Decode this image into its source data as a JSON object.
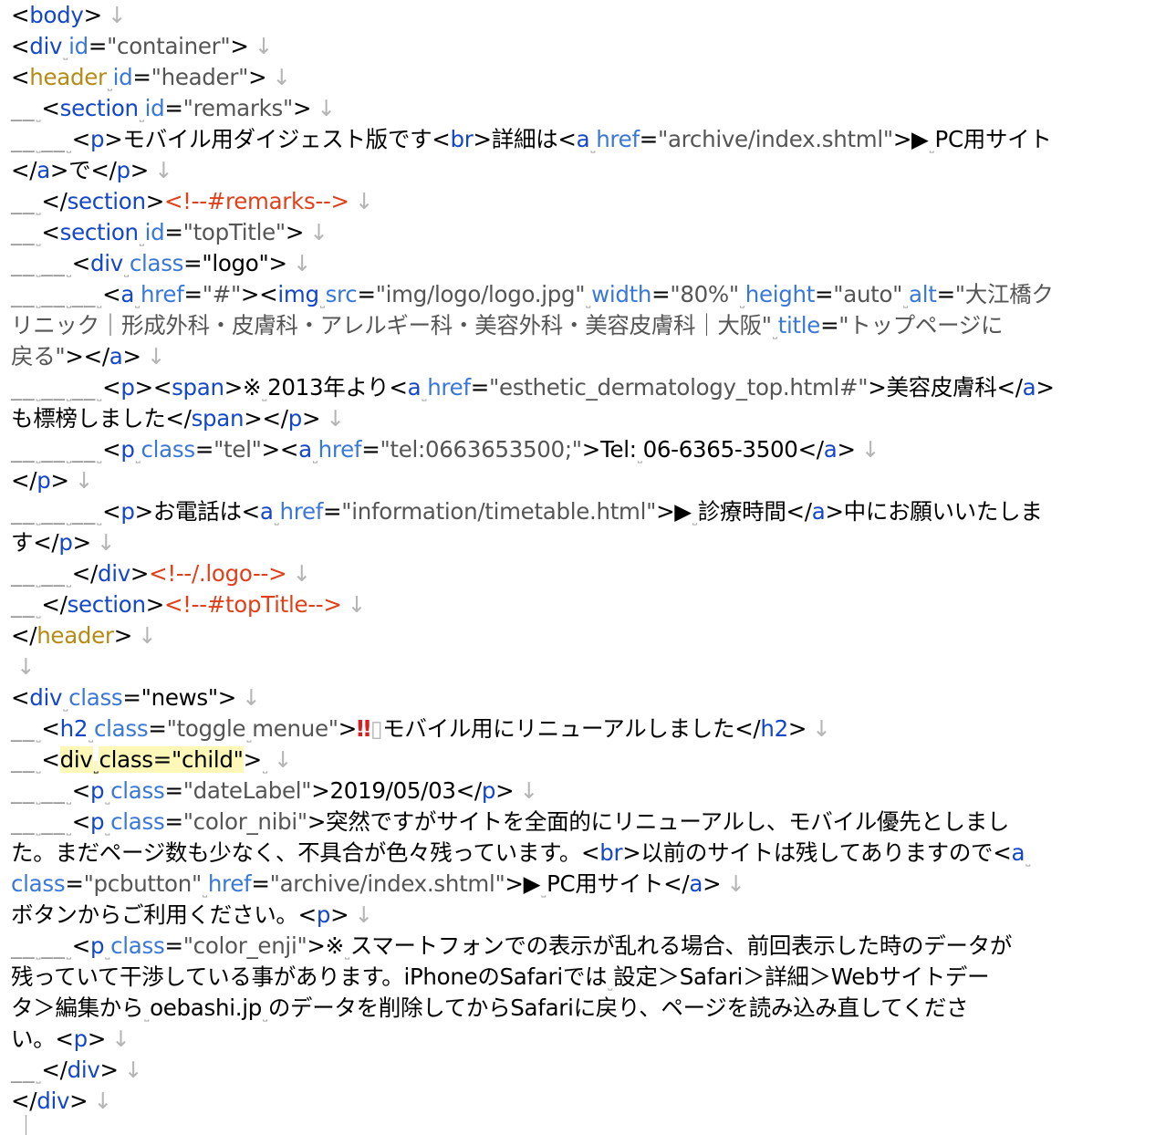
{
  "editor": {
    "lines": [
      [
        [
          "t",
          "<"
        ],
        [
          "g",
          "body"
        ],
        [
          "t",
          ">"
        ],
        [
          "eol",
          "↓"
        ]
      ],
      [
        [
          "t",
          "<"
        ],
        [
          "g",
          "div"
        ],
        [
          "s",
          "˽"
        ],
        [
          "a",
          "id"
        ],
        [
          "t",
          "="
        ],
        [
          "v",
          "\"container\""
        ],
        [
          "t",
          ">"
        ],
        [
          "eol",
          "↓"
        ]
      ],
      [
        [
          "t",
          "<"
        ],
        [
          "h",
          "header"
        ],
        [
          "s",
          "˽"
        ],
        [
          "a",
          "id"
        ],
        [
          "t",
          "="
        ],
        [
          "v",
          "\"header\""
        ],
        [
          "t",
          ">"
        ],
        [
          "eol",
          "↓"
        ]
      ],
      [
        [
          "i",
          "__"
        ],
        [
          "s",
          "˽"
        ],
        [
          "t",
          "<"
        ],
        [
          "g",
          "section"
        ],
        [
          "s",
          "˽"
        ],
        [
          "a",
          "id"
        ],
        [
          "t",
          "="
        ],
        [
          "v",
          "\"remarks\""
        ],
        [
          "t",
          ">"
        ],
        [
          "eol",
          "↓"
        ]
      ],
      [
        [
          "i",
          "__"
        ],
        [
          "s",
          "˽"
        ],
        [
          "i",
          "__"
        ],
        [
          "s",
          "˽"
        ],
        [
          "t",
          "<"
        ],
        [
          "g",
          "p"
        ],
        [
          "t",
          ">モバイル用ダイジェスト版です<"
        ],
        [
          "g",
          "br"
        ],
        [
          "t",
          ">詳細は<"
        ],
        [
          "g",
          "a"
        ],
        [
          "s",
          "˽"
        ],
        [
          "a",
          "href"
        ],
        [
          "t",
          "="
        ],
        [
          "v",
          "\"archive/index.shtml\""
        ],
        [
          "t",
          ">▶"
        ],
        [
          "s",
          "˽"
        ],
        [
          "t",
          "PC用サイト"
        ]
      ],
      [
        [
          "t",
          "</"
        ],
        [
          "g",
          "a"
        ],
        [
          "t",
          ">で</"
        ],
        [
          "g",
          "p"
        ],
        [
          "t",
          ">"
        ],
        [
          "eol",
          "↓"
        ]
      ],
      [
        [
          "i",
          "__"
        ],
        [
          "s",
          "˽"
        ],
        [
          "t",
          "</"
        ],
        [
          "g",
          "section"
        ],
        [
          "t",
          ">"
        ],
        [
          "c",
          "<!--#remarks-->"
        ],
        [
          "eol",
          "↓"
        ]
      ],
      [
        [
          "i",
          "__"
        ],
        [
          "s",
          "˽"
        ],
        [
          "t",
          "<"
        ],
        [
          "g",
          "section"
        ],
        [
          "s",
          "˽"
        ],
        [
          "a",
          "id"
        ],
        [
          "t",
          "="
        ],
        [
          "v",
          "\"topTitle\""
        ],
        [
          "t",
          ">"
        ],
        [
          "eol",
          "↓"
        ]
      ],
      [
        [
          "i",
          "__"
        ],
        [
          "s",
          "˽"
        ],
        [
          "i",
          "__"
        ],
        [
          "s",
          "˽"
        ],
        [
          "t",
          "<"
        ],
        [
          "g",
          "div"
        ],
        [
          "s",
          "˽"
        ],
        [
          "a",
          "class"
        ],
        [
          "t",
          "="
        ],
        [
          "t",
          "\"logo\""
        ],
        [
          "t",
          ">"
        ],
        [
          "eol",
          "↓"
        ]
      ],
      [
        [
          "i",
          "__"
        ],
        [
          "s",
          "˽"
        ],
        [
          "i",
          "__"
        ],
        [
          "s",
          "˽"
        ],
        [
          "i",
          "__"
        ],
        [
          "s",
          "˽"
        ],
        [
          "t",
          "<"
        ],
        [
          "g",
          "a"
        ],
        [
          "s",
          "˽"
        ],
        [
          "a",
          "href"
        ],
        [
          "t",
          "="
        ],
        [
          "v",
          "\"#\""
        ],
        [
          "t",
          ">"
        ],
        [
          "t",
          "<"
        ],
        [
          "g",
          "img"
        ],
        [
          "s",
          "˽"
        ],
        [
          "a",
          "src"
        ],
        [
          "t",
          "="
        ],
        [
          "v",
          "\"img/logo/logo.jpg\""
        ],
        [
          "s",
          "˽"
        ],
        [
          "a",
          "width"
        ],
        [
          "t",
          "="
        ],
        [
          "v",
          "\"80%\""
        ],
        [
          "s",
          "˽"
        ],
        [
          "a",
          "height"
        ],
        [
          "t",
          "="
        ],
        [
          "v",
          "\"auto\""
        ],
        [
          "s",
          "˽"
        ],
        [
          "a",
          "alt"
        ],
        [
          "t",
          "="
        ],
        [
          "v",
          "\"大江橋ク"
        ]
      ],
      [
        [
          "v",
          "リニック｜形成外科・皮膚科・アレルギー科・美容外科・美容皮膚科｜大阪\""
        ],
        [
          "s",
          "˽"
        ],
        [
          "a",
          "title"
        ],
        [
          "t",
          "="
        ],
        [
          "v",
          "\"トップページに"
        ]
      ],
      [
        [
          "v",
          "戻る\""
        ],
        [
          "t",
          ">"
        ],
        [
          "t",
          "</"
        ],
        [
          "g",
          "a"
        ],
        [
          "t",
          ">"
        ],
        [
          "eol",
          "↓"
        ]
      ],
      [
        [
          "i",
          "__"
        ],
        [
          "s",
          "˽"
        ],
        [
          "i",
          "__"
        ],
        [
          "s",
          "˽"
        ],
        [
          "i",
          "__"
        ],
        [
          "s",
          "˽"
        ],
        [
          "t",
          "<"
        ],
        [
          "g",
          "p"
        ],
        [
          "t",
          ">"
        ],
        [
          "t",
          "<"
        ],
        [
          "g",
          "span"
        ],
        [
          "t",
          ">※"
        ],
        [
          "s",
          "˽"
        ],
        [
          "t",
          "2013年より<"
        ],
        [
          "g",
          "a"
        ],
        [
          "s",
          "˽"
        ],
        [
          "a",
          "href"
        ],
        [
          "t",
          "="
        ],
        [
          "v",
          "\"esthetic_dermatology_top.html#\""
        ],
        [
          "t",
          ">美容皮膚科</"
        ],
        [
          "g",
          "a"
        ],
        [
          "t",
          ">"
        ]
      ],
      [
        [
          "t",
          "も標榜しました</"
        ],
        [
          "g",
          "span"
        ],
        [
          "t",
          ">"
        ],
        [
          "t",
          "</"
        ],
        [
          "g",
          "p"
        ],
        [
          "t",
          ">"
        ],
        [
          "eol",
          "↓"
        ]
      ],
      [
        [
          "i",
          "__"
        ],
        [
          "s",
          "˽"
        ],
        [
          "i",
          "__"
        ],
        [
          "s",
          "˽"
        ],
        [
          "i",
          "__"
        ],
        [
          "s",
          "˽"
        ],
        [
          "t",
          "<"
        ],
        [
          "g",
          "p"
        ],
        [
          "s",
          "˽"
        ],
        [
          "a",
          "class"
        ],
        [
          "t",
          "="
        ],
        [
          "v",
          "\"tel\""
        ],
        [
          "t",
          ">"
        ],
        [
          "t",
          "<"
        ],
        [
          "g",
          "a"
        ],
        [
          "s",
          "˽"
        ],
        [
          "a",
          "href"
        ],
        [
          "t",
          "="
        ],
        [
          "v",
          "\"tel:0663653500;\""
        ],
        [
          "t",
          ">Tel:"
        ],
        [
          "s",
          "˽"
        ],
        [
          "t",
          "06-6365-3500</"
        ],
        [
          "g",
          "a"
        ],
        [
          "t",
          ">"
        ],
        [
          "eol",
          "↓"
        ]
      ],
      [
        [
          "t",
          "</"
        ],
        [
          "g",
          "p"
        ],
        [
          "t",
          ">"
        ],
        [
          "eol",
          "↓"
        ]
      ],
      [
        [
          "i",
          "__"
        ],
        [
          "s",
          "˽"
        ],
        [
          "i",
          "__"
        ],
        [
          "s",
          "˽"
        ],
        [
          "i",
          "__"
        ],
        [
          "s",
          "˽"
        ],
        [
          "t",
          "<"
        ],
        [
          "g",
          "p"
        ],
        [
          "t",
          ">お電話は<"
        ],
        [
          "g",
          "a"
        ],
        [
          "s",
          "˽"
        ],
        [
          "a",
          "href"
        ],
        [
          "t",
          "="
        ],
        [
          "v",
          "\"information/timetable.html\""
        ],
        [
          "t",
          ">▶"
        ],
        [
          "s",
          "˽"
        ],
        [
          "t",
          "診療時間</"
        ],
        [
          "g",
          "a"
        ],
        [
          "t",
          ">中にお願いいたしま"
        ]
      ],
      [
        [
          "t",
          "す</"
        ],
        [
          "g",
          "p"
        ],
        [
          "t",
          ">"
        ],
        [
          "eol",
          "↓"
        ]
      ],
      [
        [
          "i",
          "__"
        ],
        [
          "s",
          "˽"
        ],
        [
          "i",
          "__"
        ],
        [
          "s",
          "˽"
        ],
        [
          "t",
          "</"
        ],
        [
          "g",
          "div"
        ],
        [
          "t",
          ">"
        ],
        [
          "c",
          "<!--/.logo-->"
        ],
        [
          "eol",
          "↓"
        ]
      ],
      [
        [
          "i",
          "__"
        ],
        [
          "s",
          "˽"
        ],
        [
          "t",
          "</"
        ],
        [
          "g",
          "section"
        ],
        [
          "t",
          ">"
        ],
        [
          "c",
          "<!--#topTitle-->"
        ],
        [
          "eol",
          "↓"
        ]
      ],
      [
        [
          "t",
          "</"
        ],
        [
          "h",
          "header"
        ],
        [
          "t",
          ">"
        ],
        [
          "eol",
          "↓"
        ]
      ],
      [
        [
          "eol",
          "↓"
        ]
      ],
      [
        [
          "t",
          "<"
        ],
        [
          "g",
          "div"
        ],
        [
          "s",
          "˽"
        ],
        [
          "a",
          "class"
        ],
        [
          "t",
          "="
        ],
        [
          "t",
          "\"news\""
        ],
        [
          "t",
          ">"
        ],
        [
          "eol",
          "↓"
        ]
      ],
      [
        [
          "i",
          "__"
        ],
        [
          "s",
          "˽"
        ],
        [
          "t",
          "<"
        ],
        [
          "g",
          "h2"
        ],
        [
          "s",
          "˽"
        ],
        [
          "a",
          "class"
        ],
        [
          "t",
          "="
        ],
        [
          "v",
          "\"toggle"
        ],
        [
          "s",
          "˽"
        ],
        [
          "v",
          "menue\""
        ],
        [
          "t",
          ">"
        ],
        [
          "e",
          "‼"
        ],
        [
          "x",
          "▯"
        ],
        [
          "t",
          "モバイル用にリニューアルしました</"
        ],
        [
          "g",
          "h2"
        ],
        [
          "t",
          ">"
        ],
        [
          "eol",
          "↓"
        ]
      ],
      [
        [
          "i",
          "__"
        ],
        [
          "s",
          "˽"
        ],
        [
          "t",
          "<"
        ],
        [
          "hl",
          "div"
        ],
        [
          "hls",
          "˽"
        ],
        [
          "hla",
          "class"
        ],
        [
          "hlt",
          "=\"child\""
        ],
        [
          "t",
          ">"
        ],
        [
          "s",
          "˽"
        ],
        [
          "eol",
          "↓"
        ]
      ],
      [
        [
          "i",
          "__"
        ],
        [
          "s",
          "˽"
        ],
        [
          "i",
          "__"
        ],
        [
          "s",
          "˽"
        ],
        [
          "t",
          "<"
        ],
        [
          "g",
          "p"
        ],
        [
          "s",
          "˽"
        ],
        [
          "a",
          "class"
        ],
        [
          "t",
          "="
        ],
        [
          "v",
          "\"dateLabel\""
        ],
        [
          "t",
          ">2019/05/03</"
        ],
        [
          "g",
          "p"
        ],
        [
          "t",
          ">"
        ],
        [
          "eol",
          "↓"
        ]
      ],
      [
        [
          "i",
          "__"
        ],
        [
          "s",
          "˽"
        ],
        [
          "i",
          "__"
        ],
        [
          "s",
          "˽"
        ],
        [
          "t",
          "<"
        ],
        [
          "g",
          "p"
        ],
        [
          "s",
          "˽"
        ],
        [
          "a",
          "class"
        ],
        [
          "t",
          "="
        ],
        [
          "v",
          "\"color_nibi\""
        ],
        [
          "t",
          ">突然ですがサイトを全面的にリニューアルし、モバイル優先としまし"
        ]
      ],
      [
        [
          "t",
          "た。まだページ数も少なく、不具合が色々残っています。<"
        ],
        [
          "g",
          "br"
        ],
        [
          "t",
          ">以前のサイトは残してありますので<"
        ],
        [
          "g",
          "a"
        ],
        [
          "s",
          "˽"
        ]
      ],
      [
        [
          "a",
          "class"
        ],
        [
          "t",
          "="
        ],
        [
          "v",
          "\"pcbutton\""
        ],
        [
          "s",
          "˽"
        ],
        [
          "a",
          "href"
        ],
        [
          "t",
          "="
        ],
        [
          "v",
          "\"archive/index.shtml\""
        ],
        [
          "t",
          ">▶"
        ],
        [
          "s",
          "˽"
        ],
        [
          "t",
          "PC用サイト</"
        ],
        [
          "g",
          "a"
        ],
        [
          "t",
          ">"
        ],
        [
          "eol",
          "↓"
        ]
      ],
      [
        [
          "t",
          "ボタンからご利用ください。<"
        ],
        [
          "g",
          "p"
        ],
        [
          "t",
          ">"
        ],
        [
          "eol",
          "↓"
        ]
      ],
      [
        [
          "i",
          "__"
        ],
        [
          "s",
          "˽"
        ],
        [
          "i",
          "__"
        ],
        [
          "s",
          "˽"
        ],
        [
          "t",
          "<"
        ],
        [
          "g",
          "p"
        ],
        [
          "s",
          "˽"
        ],
        [
          "a",
          "class"
        ],
        [
          "t",
          "="
        ],
        [
          "v",
          "\"color_enji\""
        ],
        [
          "t",
          ">※"
        ],
        [
          "s",
          "˽"
        ],
        [
          "t",
          "スマートフォンでの表示が乱れる場合、前回表示した時のデータが"
        ]
      ],
      [
        [
          "t",
          "残っていて干渉している事があります。iPhoneのSafariでは"
        ],
        [
          "s",
          "˽"
        ],
        [
          "t",
          "設定＞Safari＞詳細＞Webサイトデー"
        ]
      ],
      [
        [
          "t",
          "タ＞編集から"
        ],
        [
          "s",
          "˽"
        ],
        [
          "t",
          "oebashi.jp"
        ],
        [
          "s",
          "˽"
        ],
        [
          "t",
          "のデータを削除してからSafariに戻り、ページを読み込み直してくださ"
        ]
      ],
      [
        [
          "t",
          "い。<"
        ],
        [
          "g",
          "p"
        ],
        [
          "t",
          ">"
        ],
        [
          "eol",
          "↓"
        ]
      ],
      [
        [
          "i",
          "__"
        ],
        [
          "s",
          "˽"
        ],
        [
          "t",
          "</"
        ],
        [
          "g",
          "div"
        ],
        [
          "t",
          ">"
        ],
        [
          "eol",
          "↓"
        ]
      ],
      [
        [
          "t",
          "</"
        ],
        [
          "g",
          "div"
        ],
        [
          "t",
          ">"
        ],
        [
          "eol",
          "↓"
        ]
      ]
    ]
  }
}
